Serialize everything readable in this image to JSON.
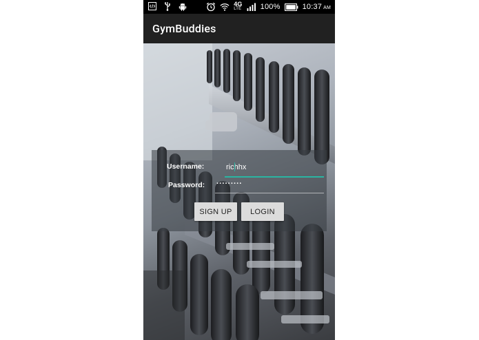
{
  "status_bar": {
    "battery_percent": "100%",
    "time": "10:37",
    "time_suffix": "AM",
    "network": "4G",
    "network_sub": "LTE",
    "icons": [
      "developer-code-icon",
      "usb-icon",
      "android-icon",
      "alarm-icon",
      "wifi-icon",
      "4g-lte-icon",
      "signal-icon",
      "battery-icon"
    ]
  },
  "app_bar": {
    "title": "GymBuddies"
  },
  "login": {
    "username_label": "Username:",
    "username_value": "richhx",
    "password_label": "Password:",
    "password_value": "·········",
    "signup_label": "SIGN UP",
    "login_label": "LOGIN"
  },
  "colors": {
    "app_bar_bg": "#212121",
    "accent": "#2ab5a2",
    "button_bg": "#dcdcdc"
  }
}
